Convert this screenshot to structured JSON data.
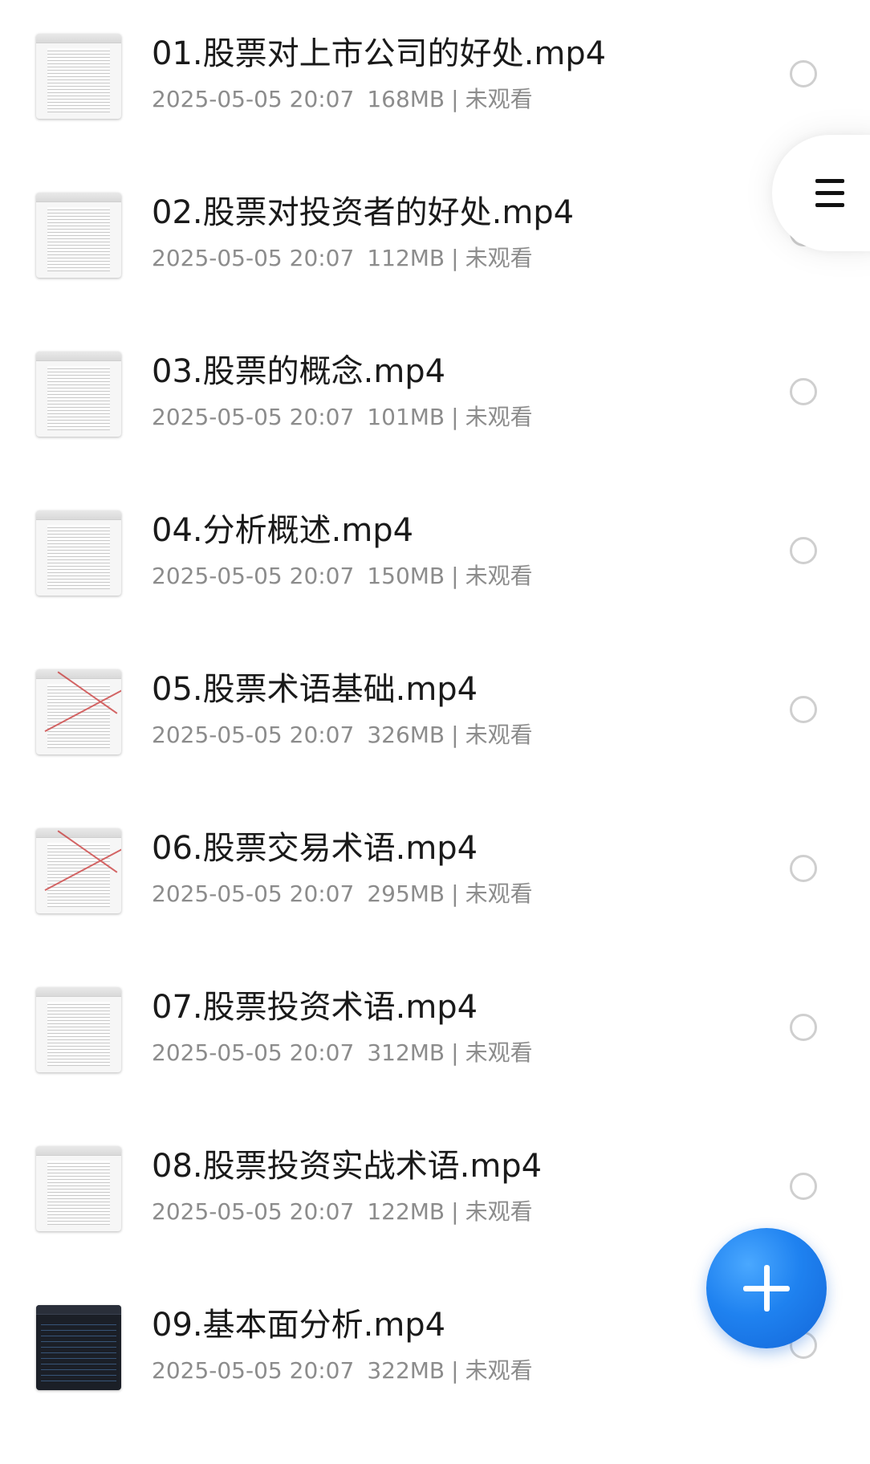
{
  "files": [
    {
      "name": "01.股票对上市公司的好处.mp4",
      "date": "2025-05-05 20:07",
      "size": "168MB",
      "status": "未观看",
      "thumb": "doc"
    },
    {
      "name": "02.股票对投资者的好处.mp4",
      "date": "2025-05-05 20:07",
      "size": "112MB",
      "status": "未观看",
      "thumb": "doc"
    },
    {
      "name": "03.股票的概念.mp4",
      "date": "2025-05-05 20:07",
      "size": "101MB",
      "status": "未观看",
      "thumb": "doc"
    },
    {
      "name": "04.分析概述.mp4",
      "date": "2025-05-05 20:07",
      "size": "150MB",
      "status": "未观看",
      "thumb": "doc"
    },
    {
      "name": "05.股票术语基础.mp4",
      "date": "2025-05-05 20:07",
      "size": "326MB",
      "status": "未观看",
      "thumb": "doc-annotated"
    },
    {
      "name": "06.股票交易术语.mp4",
      "date": "2025-05-05 20:07",
      "size": "295MB",
      "status": "未观看",
      "thumb": "doc-annotated"
    },
    {
      "name": "07.股票投资术语.mp4",
      "date": "2025-05-05 20:07",
      "size": "312MB",
      "status": "未观看",
      "thumb": "doc"
    },
    {
      "name": "08.股票投资实战术语.mp4",
      "date": "2025-05-05 20:07",
      "size": "122MB",
      "status": "未观看",
      "thumb": "doc"
    },
    {
      "name": "09.基本面分析.mp4",
      "date": "2025-05-05 20:07",
      "size": "322MB",
      "status": "未观看",
      "thumb": "dark"
    }
  ],
  "menu": {
    "icon": "menu-icon"
  },
  "fab": {
    "icon": "plus-icon",
    "color": "#1f82f0"
  }
}
